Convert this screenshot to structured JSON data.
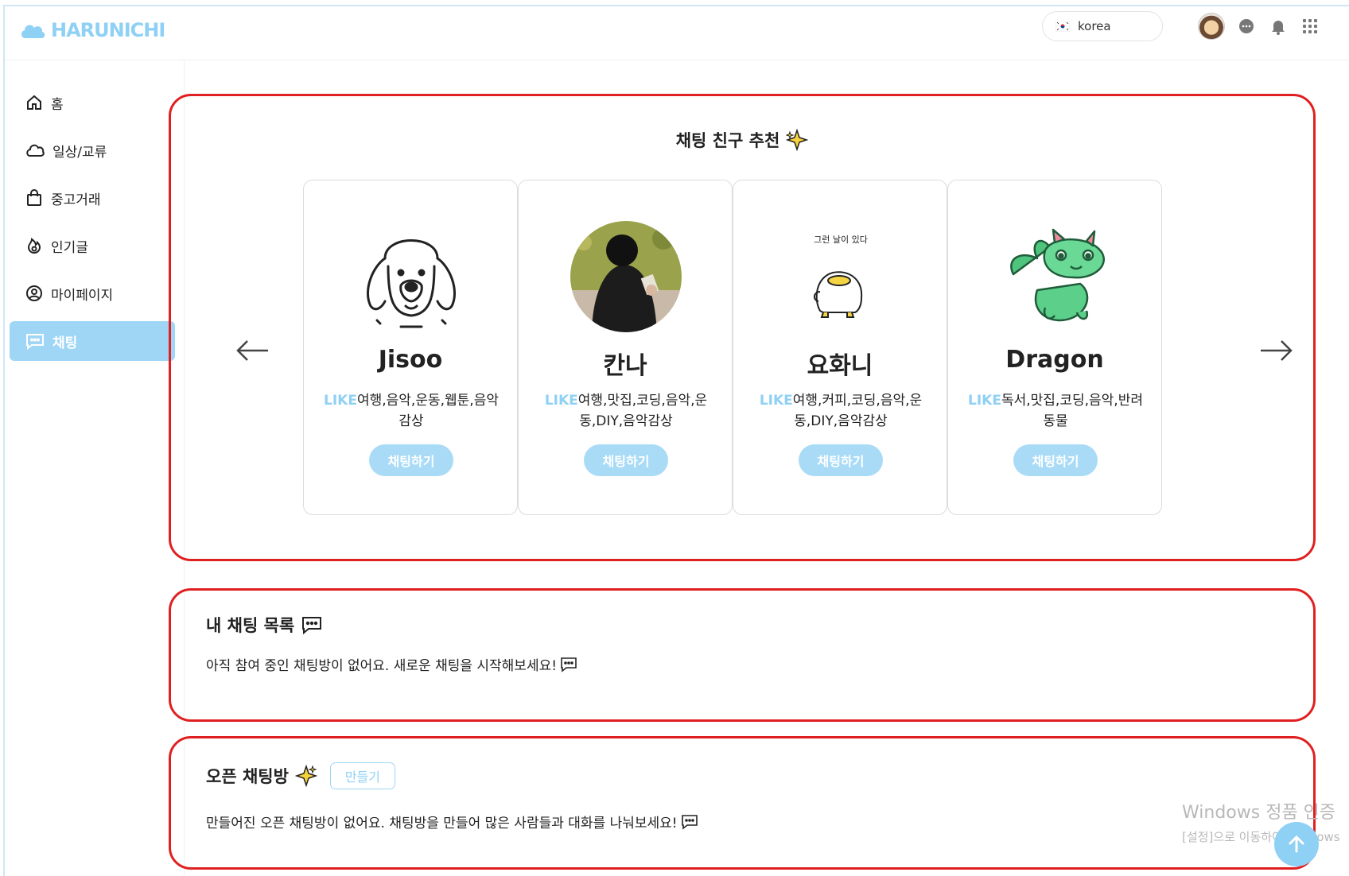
{
  "brand": {
    "name": "HARUNICHI",
    "color": "#8fd0f5"
  },
  "header": {
    "language": "korea",
    "icons": [
      "korea-flag-icon",
      "avatar",
      "chat-bubble-icon",
      "bell-icon",
      "apps-grid-icon"
    ]
  },
  "sidebar": {
    "items": [
      {
        "label": "홈",
        "icon": "home-icon",
        "active": false
      },
      {
        "label": "일상/교류",
        "icon": "cloud-icon",
        "active": false
      },
      {
        "label": "중고거래",
        "icon": "shopping-bag-icon",
        "active": false
      },
      {
        "label": "인기글",
        "icon": "fire-icon",
        "active": false
      },
      {
        "label": "마이페이지",
        "icon": "user-circle-icon",
        "active": false
      },
      {
        "label": "채팅",
        "icon": "chat-icon",
        "active": true
      }
    ]
  },
  "recommend": {
    "title": "채팅 친구 추천",
    "title_icon": "sparkle-icon",
    "cards": [
      {
        "name": "Jisoo",
        "like_tag": "LIKE",
        "interests": "여행,음악,운동,웹툰,음악감상",
        "button": "채팅하기",
        "image": "dog-line-drawing"
      },
      {
        "name": "칸나",
        "like_tag": "LIKE",
        "interests": "여행,맛집,코딩,음악,운동,DIY,음악감상",
        "button": "채팅하기",
        "image": "person-photo"
      },
      {
        "name": "요화니",
        "like_tag": "LIKE",
        "interests": "여행,커피,코딩,음악,운동,DIY,음악감상",
        "button": "채팅하기",
        "image": "duck-doodle",
        "image_caption": "그런 날이 있다"
      },
      {
        "name": "Dragon",
        "like_tag": "LIKE",
        "interests": "독서,맛집,코딩,음악,반려동물",
        "button": "채팅하기",
        "image": "green-dragon"
      }
    ]
  },
  "my_chats": {
    "title": "내 채팅 목록",
    "empty_message": "아직 참여 중인 채팅방이 없어요. 새로운 채팅을 시작해보세요!"
  },
  "open_chats": {
    "title": "오픈 채팅방",
    "create_button": "만들기",
    "empty_message": "만들어진 오픈 채팅방이 없어요. 채팅방을 만들어 많은 사람들과 대화를 나눠보세요!"
  },
  "watermark": {
    "line1": "Windows 정품 인증",
    "line2": "[설정]으로 이동하여 Windows"
  },
  "colors": {
    "accent": "#8fd0f5",
    "active_nav": "#9fd6f6",
    "button": "#a9dbf7",
    "annotation_border": "#e02020"
  }
}
